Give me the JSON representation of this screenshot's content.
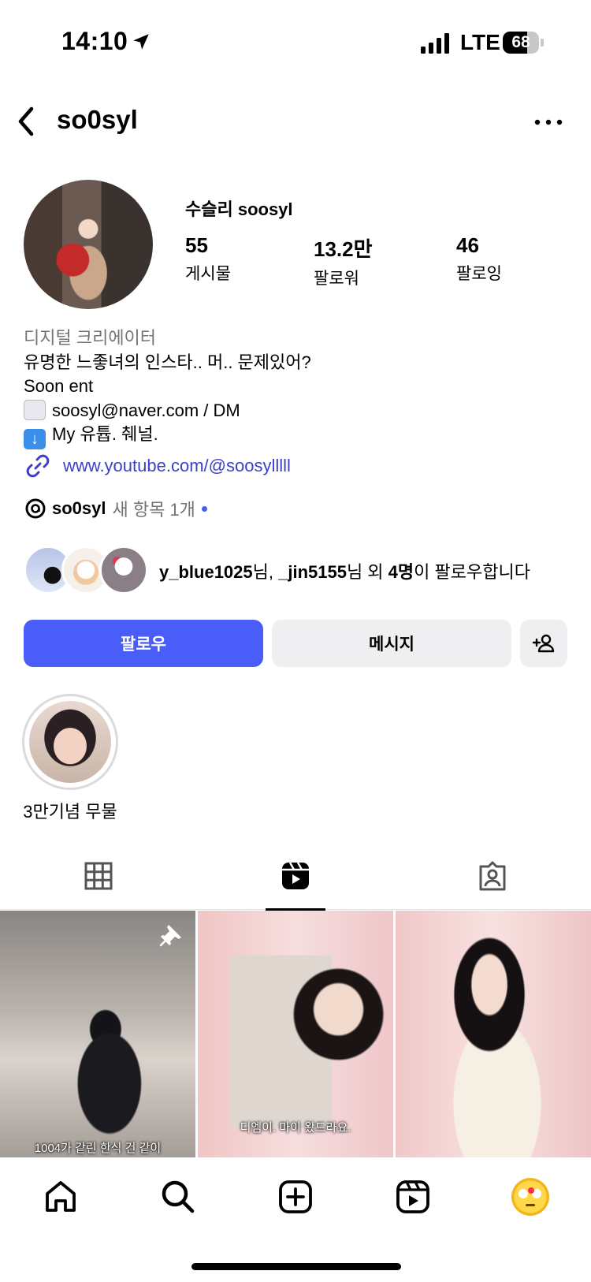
{
  "status_bar": {
    "time": "14:10",
    "network": "LTE",
    "battery_percent": "68",
    "battery_level": 0.68
  },
  "header": {
    "username": "so0syl"
  },
  "profile": {
    "display_name": "수슬리 soosyl",
    "stats": [
      {
        "value": "55",
        "label": "게시물"
      },
      {
        "value": "13.2만",
        "label": "팔로워"
      },
      {
        "value": "46",
        "label": "팔로잉"
      }
    ],
    "category": "디지털 크리에이터",
    "bio_lines": [
      "유명한 느좋녀의 인스타.. 머.. 문제있어?",
      "Soon ent",
      "soosyl@naver.com / DM",
      "My 유튭. 췌널."
    ],
    "link": "www.youtube.com/@soosylllll"
  },
  "threads": {
    "name": "so0syl",
    "new_items": "새 항목 1개"
  },
  "mutual": {
    "user1": "y_blue1025",
    "suffix1": "님, ",
    "user2": "_jin5155",
    "suffix2": "님 외 ",
    "count": "4명",
    "suffix3": "이 팔로우합니다"
  },
  "buttons": {
    "follow": "팔로우",
    "message": "메시지"
  },
  "highlights": [
    {
      "label": "3만기념 무물"
    }
  ],
  "grid": {
    "captions": [
      "1004가 같린 한식 건 같이",
      "디엠이. 마이 왔드라요.",
      ""
    ]
  },
  "icons": {
    "back": "chevron-left-icon",
    "more": "more-horizontal-icon",
    "link": "link-icon",
    "threads": "threads-icon",
    "add_user": "add-user-icon",
    "grid": "grid-icon",
    "reels": "reels-icon",
    "tagged": "tagged-icon",
    "pin": "pin-icon",
    "home": "home-icon",
    "search": "search-icon",
    "create": "create-icon"
  },
  "colors": {
    "accent": "#4a5df9",
    "link": "#3b41c7",
    "notification": "#ff2d46"
  }
}
